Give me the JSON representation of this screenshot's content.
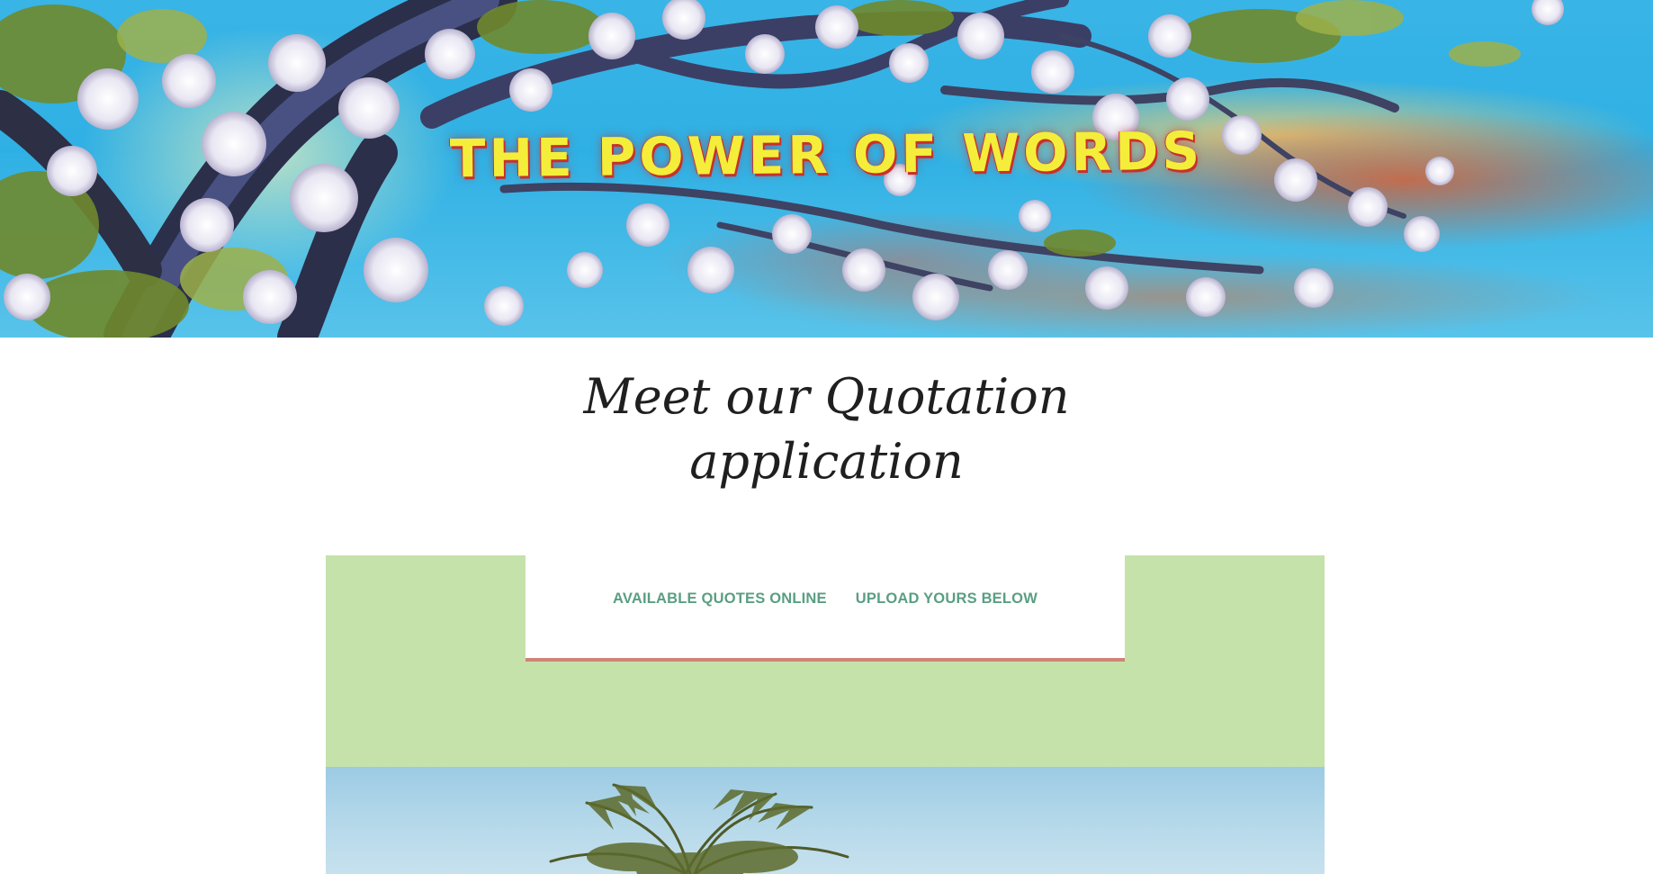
{
  "hero": {
    "title": "THE POWER OF WORDS",
    "colors": {
      "title": "#f4ee3a",
      "title_outline": "#c9302c",
      "sky": "#2fb0e4"
    }
  },
  "heading": {
    "line1": "Meet our Quotation",
    "line2": "application"
  },
  "nav": {
    "links": [
      {
        "label": "AVAILABLE QUOTES ONLINE"
      },
      {
        "label": "UPLOAD YOURS BELOW"
      }
    ],
    "colors": {
      "link": "#5a9e83",
      "underline": "#cd8576",
      "section_bg": "#c5e2aa"
    }
  },
  "photo": {
    "subject": "palm-tree-photo"
  }
}
